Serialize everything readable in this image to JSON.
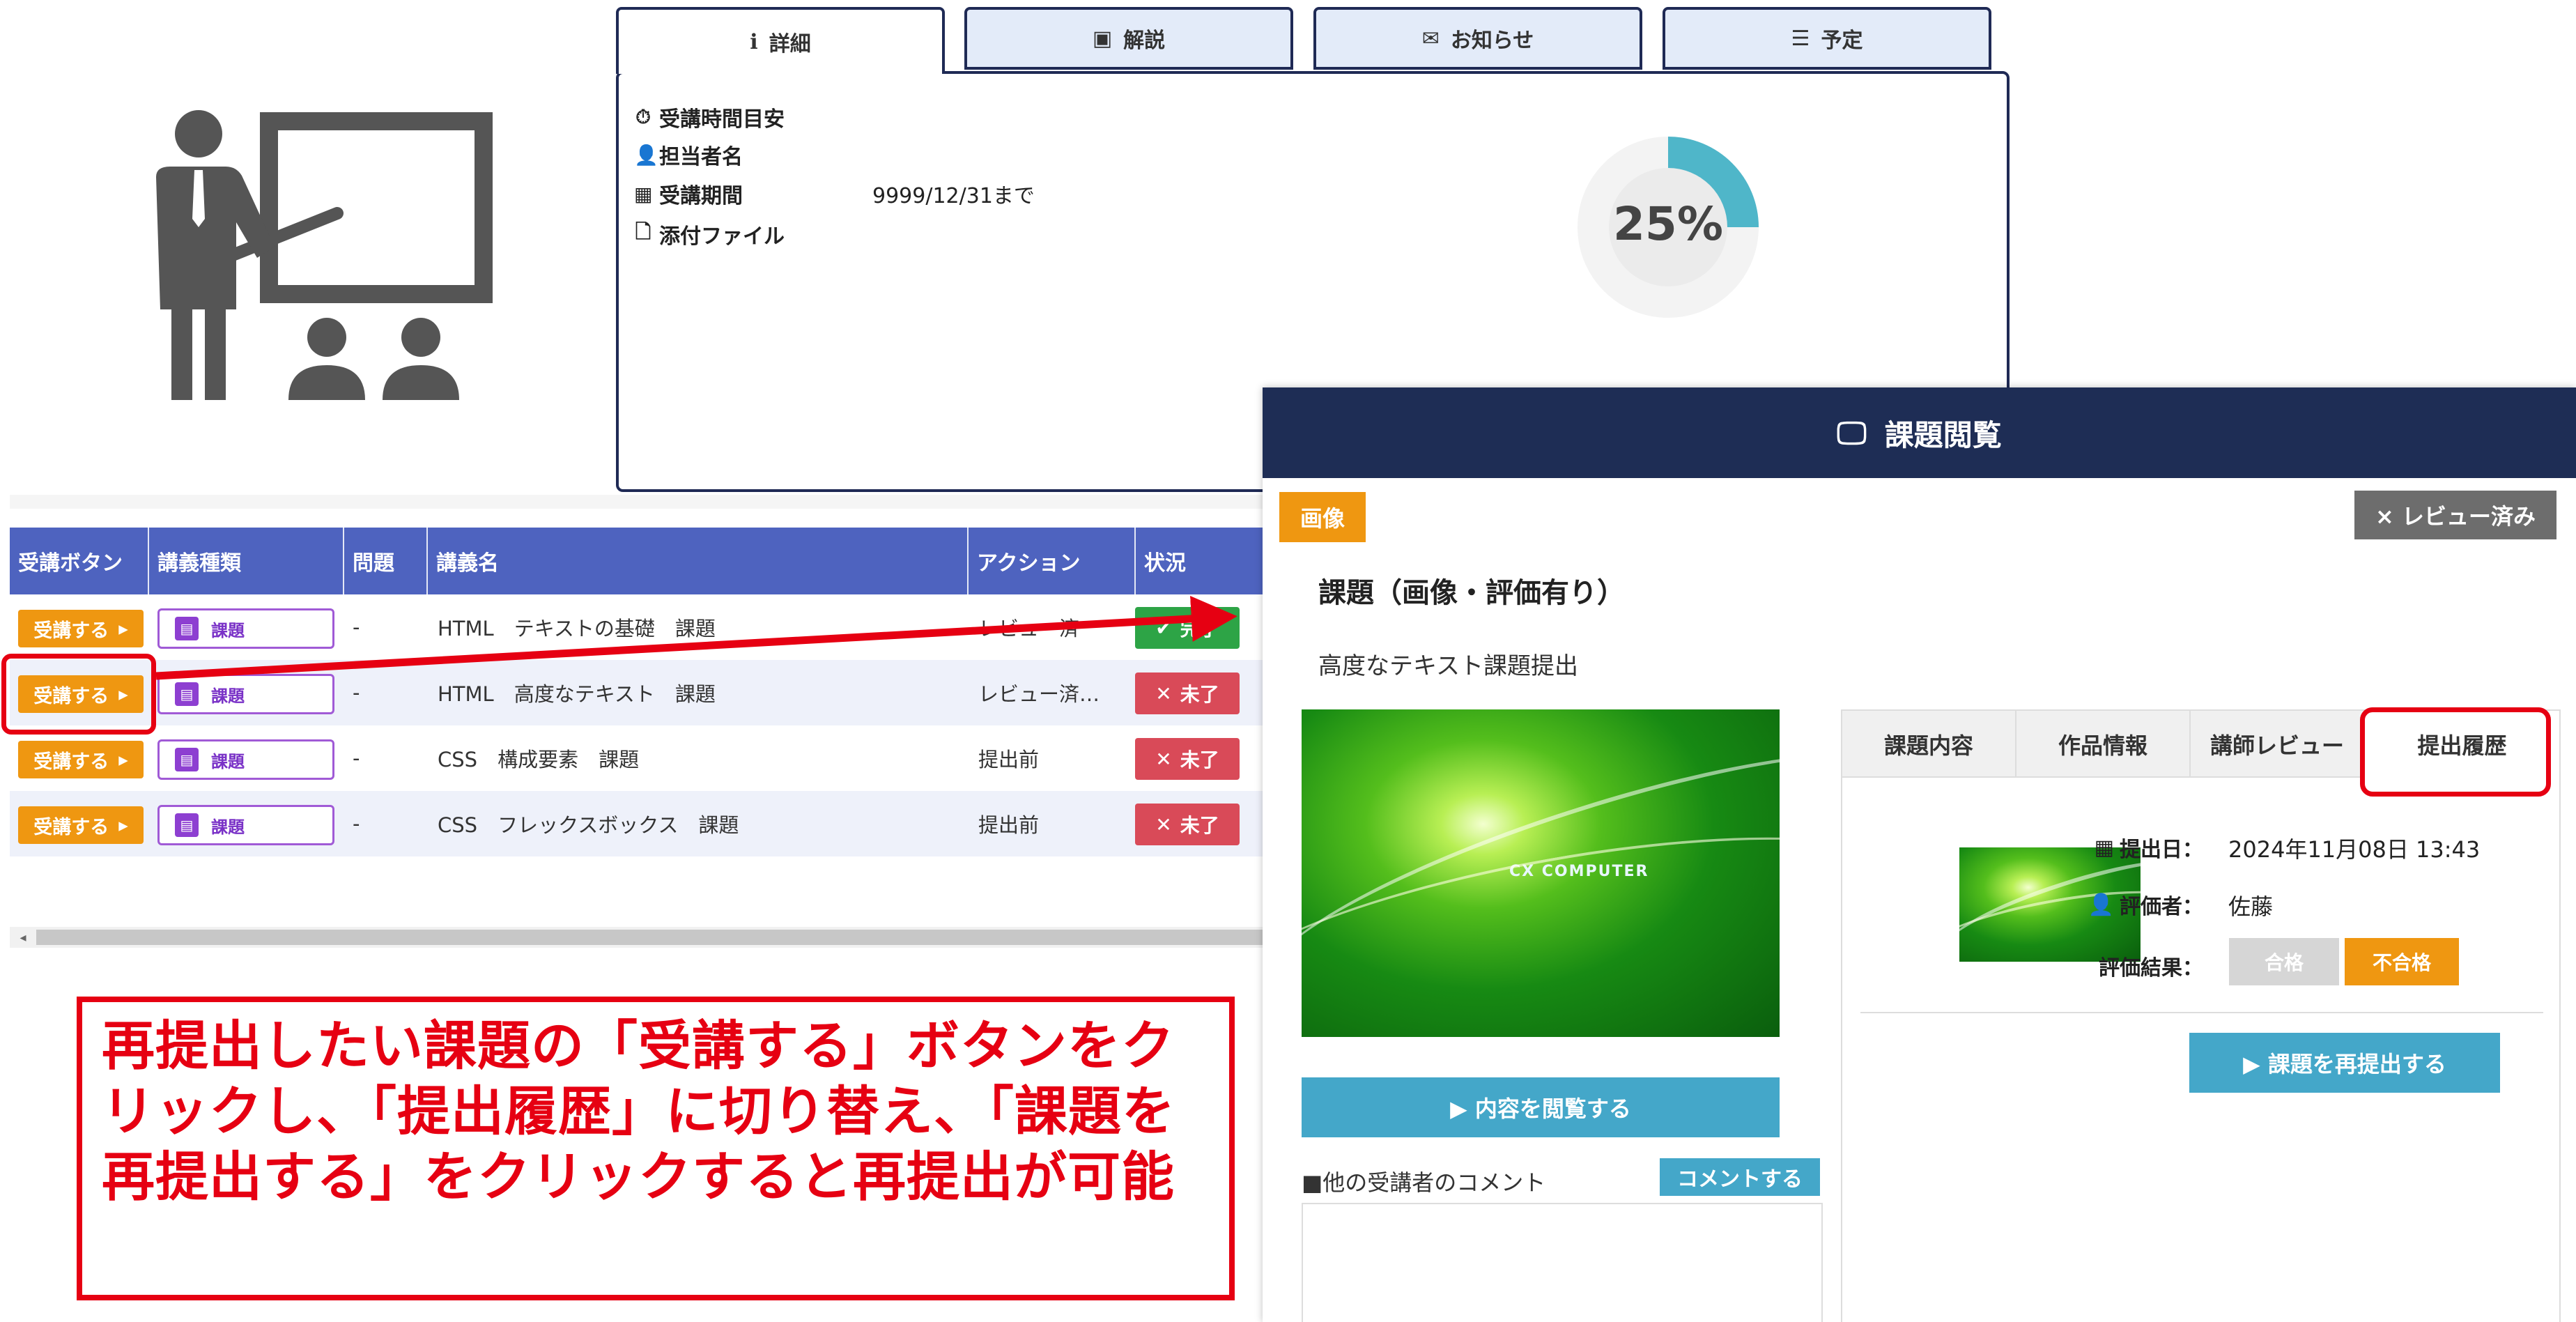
{
  "detail_panel": {
    "tabs": [
      {
        "icon": "info-icon",
        "label": "詳細"
      },
      {
        "icon": "id-card-icon",
        "label": "解説"
      },
      {
        "icon": "envelope-icon",
        "label": "お知らせ"
      },
      {
        "icon": "list-icon",
        "label": "予定"
      }
    ],
    "fields": [
      {
        "icon": "stopwatch-icon",
        "label": "受講時間目安",
        "value": ""
      },
      {
        "icon": "user-icon",
        "label": "担当者名",
        "value": ""
      },
      {
        "icon": "calendar-icon",
        "label": "受講期間",
        "value": "9999/12/31まで"
      },
      {
        "icon": "file-icon",
        "label": "添付ファイル",
        "value": ""
      }
    ],
    "progress": {
      "percent": 25,
      "label": "25%"
    }
  },
  "course_table": {
    "headers": [
      "受講ボタン",
      "講義種類",
      "問題",
      "講義名",
      "アクション",
      "状況"
    ],
    "rows": [
      {
        "enroll_label": "受講する",
        "type_label": "課題",
        "problem": "-",
        "name": "HTML　テキストの基礎　課題",
        "action": "レビュー済",
        "status": "完了",
        "status_kind": "done"
      },
      {
        "enroll_label": "受講する",
        "type_label": "課題",
        "problem": "-",
        "name": "HTML　高度なテキスト　課題",
        "action": "レビュー済…",
        "status": "未了",
        "status_kind": "todo"
      },
      {
        "enroll_label": "受講する",
        "type_label": "課題",
        "problem": "-",
        "name": "CSS　構成要素　課題",
        "action": "提出前",
        "status": "未了",
        "status_kind": "todo"
      },
      {
        "enroll_label": "受講する",
        "type_label": "課題",
        "problem": "-",
        "name": "CSS　フレックスボックス　課題",
        "action": "提出前",
        "status": "未了",
        "status_kind": "todo"
      }
    ]
  },
  "callout": {
    "text": "再提出したい課題の「受講する」ボタンをクリックし、「提出履歴」に切り替え、「課題を再提出する」をクリックすると再提出が可能"
  },
  "modal": {
    "title": "課題閲覧",
    "title_icon": "monitor-icon",
    "media_badge": "画像",
    "review_badge": "× レビュー済み",
    "assignment_title": "課題（画像・評価有り）",
    "assignment_desc": "高度なテキスト課題提出",
    "preview_logo_text": "CX COMPUTER",
    "view_content_label": "▶ 内容を閲覧する",
    "comments_label": "■他の受講者のコメント",
    "comment_button_label": "コメントする",
    "inner_tabs": [
      "課題内容",
      "作品情報",
      "講師レビュー",
      "提出履歴"
    ],
    "active_inner_tab": 3,
    "history": {
      "submit_date_label": "提出日：",
      "submit_date_value": "2024年11月08日 13:43",
      "evaluator_label": "評価者：",
      "evaluator_value": "佐藤",
      "result_label": "評価結果：",
      "pass_label": "合格",
      "fail_label": "不合格"
    },
    "resubmit_label": "▶ 課題を再提出する"
  },
  "colors": {
    "table_header": "#4e63bf",
    "enroll_orange": "#ef9711",
    "done_green": "#2da446",
    "todo_red": "#d94a58",
    "annotation_red": "#e60012",
    "modal_header": "#1e2d55",
    "accent_blue": "#44a7c9",
    "progress_teal": "#4fb6c9"
  }
}
